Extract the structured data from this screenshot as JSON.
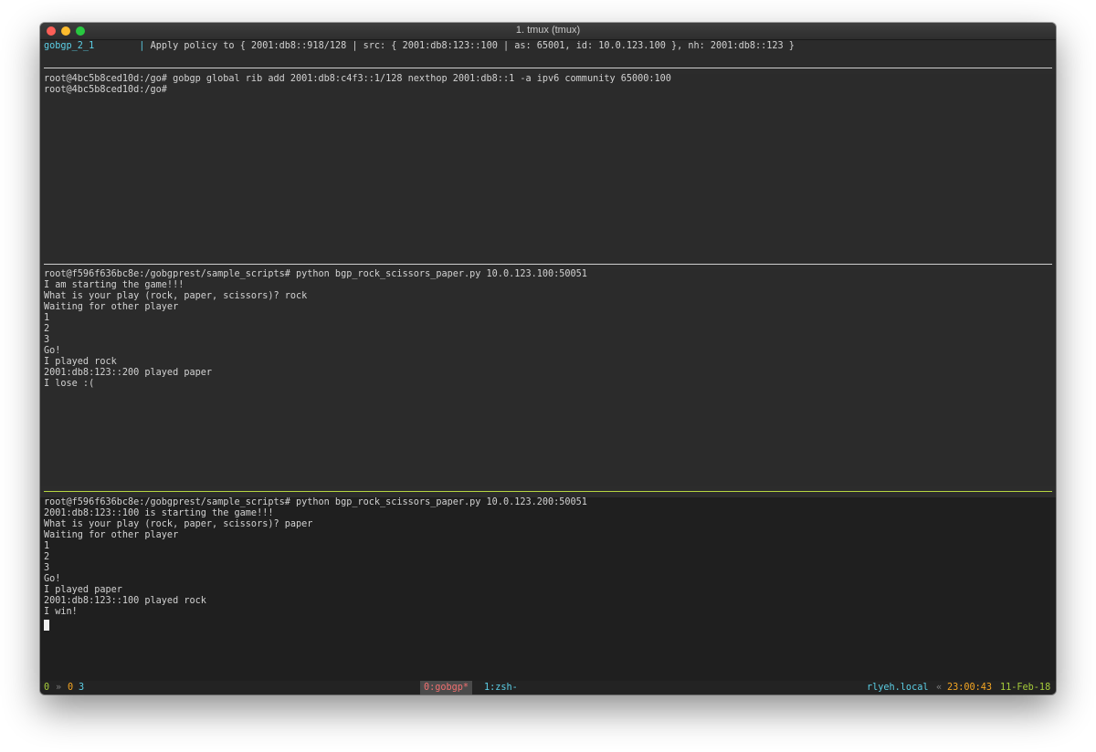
{
  "window": {
    "title": "1. tmux (tmux)"
  },
  "top_pane": {
    "host": "gobgp_2_1",
    "separator": "|",
    "message": "Apply policy to { 2001:db8::918/128 | src: { 2001:db8:123::100 | as: 65001, id: 10.0.123.100 }, nh: 2001:db8::123 }"
  },
  "pane_gobgp": {
    "lines": [
      "root@4bc5b8ced10d:/go# gobgp global rib add 2001:db8:c4f3::1/128 nexthop 2001:db8::1 -a ipv6 community 65000:100",
      "root@4bc5b8ced10d:/go#"
    ]
  },
  "pane_player1": {
    "lines": [
      "root@f596f636bc8e:/gobgprest/sample_scripts# python bgp_rock_scissors_paper.py 10.0.123.100:50051",
      "I am starting the game!!!",
      "What is your play (rock, paper, scissors)? rock",
      "Waiting for other player",
      "1",
      "2",
      "3",
      "Go!",
      "I played rock",
      "2001:db8:123::200 played paper",
      "I lose :("
    ]
  },
  "pane_player2": {
    "lines": [
      "root@f596f636bc8e:/gobgprest/sample_scripts# python bgp_rock_scissors_paper.py 10.0.123.200:50051",
      "2001:db8:123::100 is starting the game!!!",
      "What is your play (rock, paper, scissors)? paper",
      "Waiting for other player",
      "1",
      "2",
      "3",
      "Go!",
      "I played paper",
      "2001:db8:123::100 played rock",
      "I win!"
    ]
  },
  "status_bar": {
    "session": "0",
    "arrow": "»",
    "window_index": "0",
    "pane_count": "3",
    "windows": [
      {
        "label": "0:gobgp*",
        "active": true
      },
      {
        "label": "1:zsh-",
        "active": false
      }
    ],
    "hostname": "rlyeh.local",
    "host_arrow": "«",
    "time": "23:00:43",
    "date": "11-Feb-18"
  },
  "colors": {
    "window_bg": "#2c2c2c",
    "active_pane_bg": "#1f1f1f",
    "text": "#d2d2d2",
    "cyan": "#5ccfe6",
    "green": "#a6cc3a",
    "orange": "#f5a623",
    "active_separator": "#b7d640"
  }
}
